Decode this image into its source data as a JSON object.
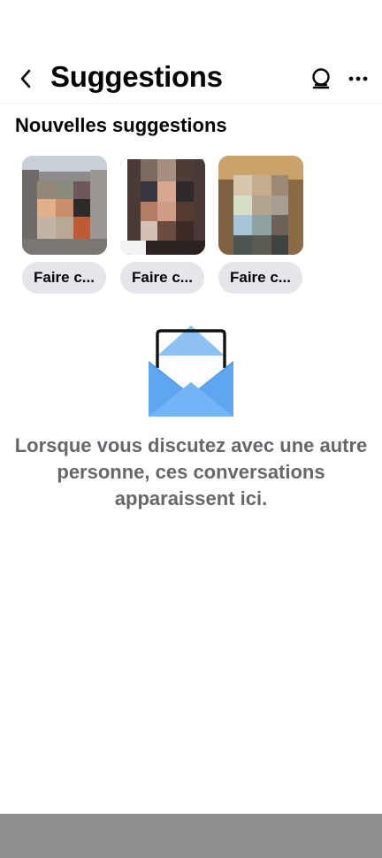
{
  "header": {
    "title": "Suggestions",
    "back_icon": "chevron-left-icon",
    "status_icon": "lightbulb-icon",
    "more_icon": "more-horizontal-icon"
  },
  "suggestions": {
    "title": "Nouvelles suggestions",
    "items": [
      {
        "button_label": "Faire c...",
        "photo": "blurred-photo"
      },
      {
        "button_label": "Faire c...",
        "photo": "blurred-photo"
      },
      {
        "button_label": "Faire c...",
        "photo": "blurred-photo"
      }
    ]
  },
  "empty_state": {
    "icon": "envelope-icon",
    "message": "Lorsque vous discutez avec une autre personne, ces conversations apparaissent ici."
  },
  "colors": {
    "text_primary": "#050505",
    "text_secondary": "#65676b",
    "button_bg": "#e4e6eb",
    "envelope_blue": "#5aa0ea",
    "nav_bar": "#8e8e8e"
  }
}
